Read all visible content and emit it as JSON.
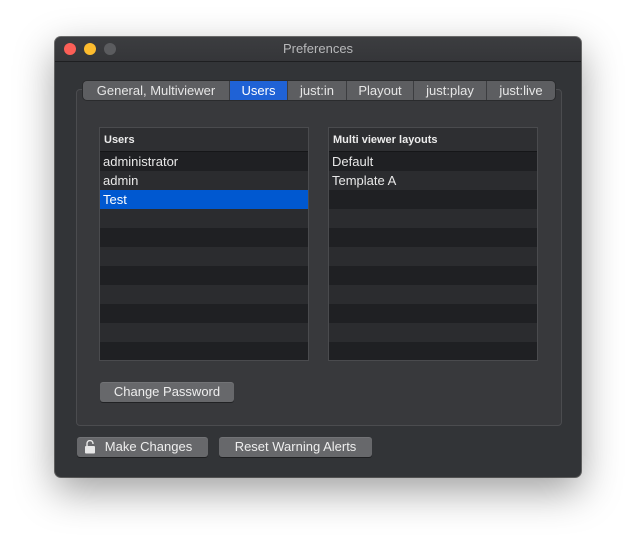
{
  "window": {
    "title": "Preferences"
  },
  "tabs": [
    {
      "label": "General, Multiviewer",
      "active": false
    },
    {
      "label": "Users",
      "active": true
    },
    {
      "label": "just:in",
      "active": false
    },
    {
      "label": "Playout",
      "active": false
    },
    {
      "label": "just:play",
      "active": false
    },
    {
      "label": "just:live",
      "active": false
    }
  ],
  "users_table": {
    "header": "Users",
    "rows": [
      "administrator",
      "admin",
      "Test"
    ],
    "selected_index": 2
  },
  "layouts_table": {
    "header": "Multi viewer layouts",
    "rows": [
      "Default",
      "Template A"
    ]
  },
  "buttons": {
    "change_password": "Change Password",
    "make_changes": "Make Changes",
    "reset_warning_alerts": "Reset Warning Alerts"
  },
  "colors": {
    "accent": "#1f62d6",
    "selection": "#0058d0",
    "window_bg": "#323437"
  }
}
